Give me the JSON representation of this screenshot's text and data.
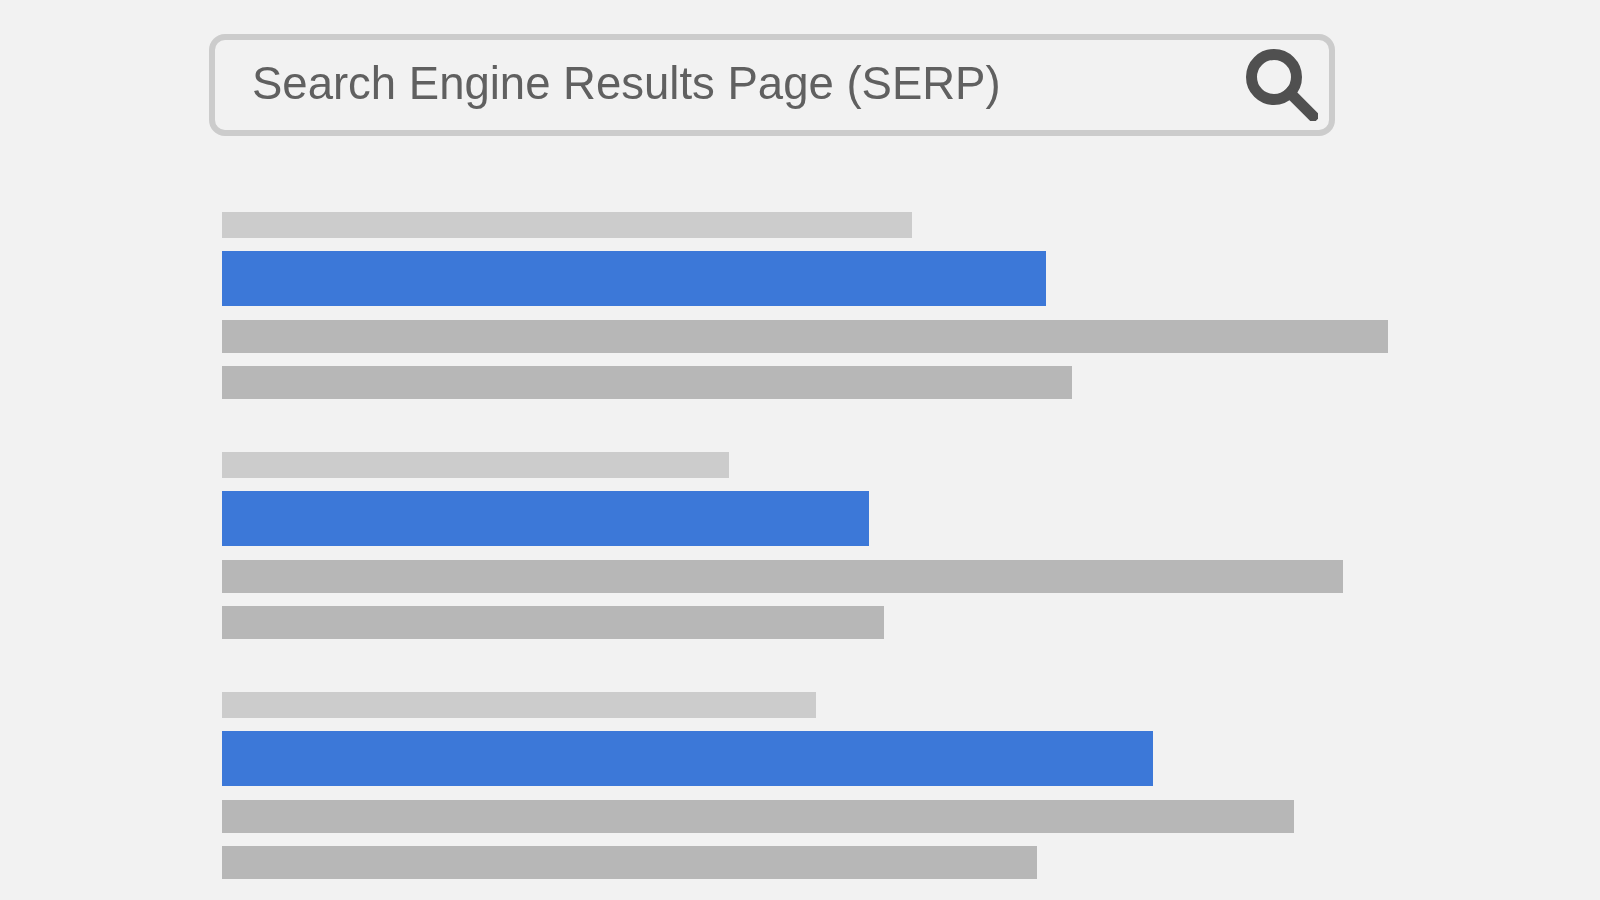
{
  "search": {
    "value": "Search Engine Results Page (SERP)"
  }
}
